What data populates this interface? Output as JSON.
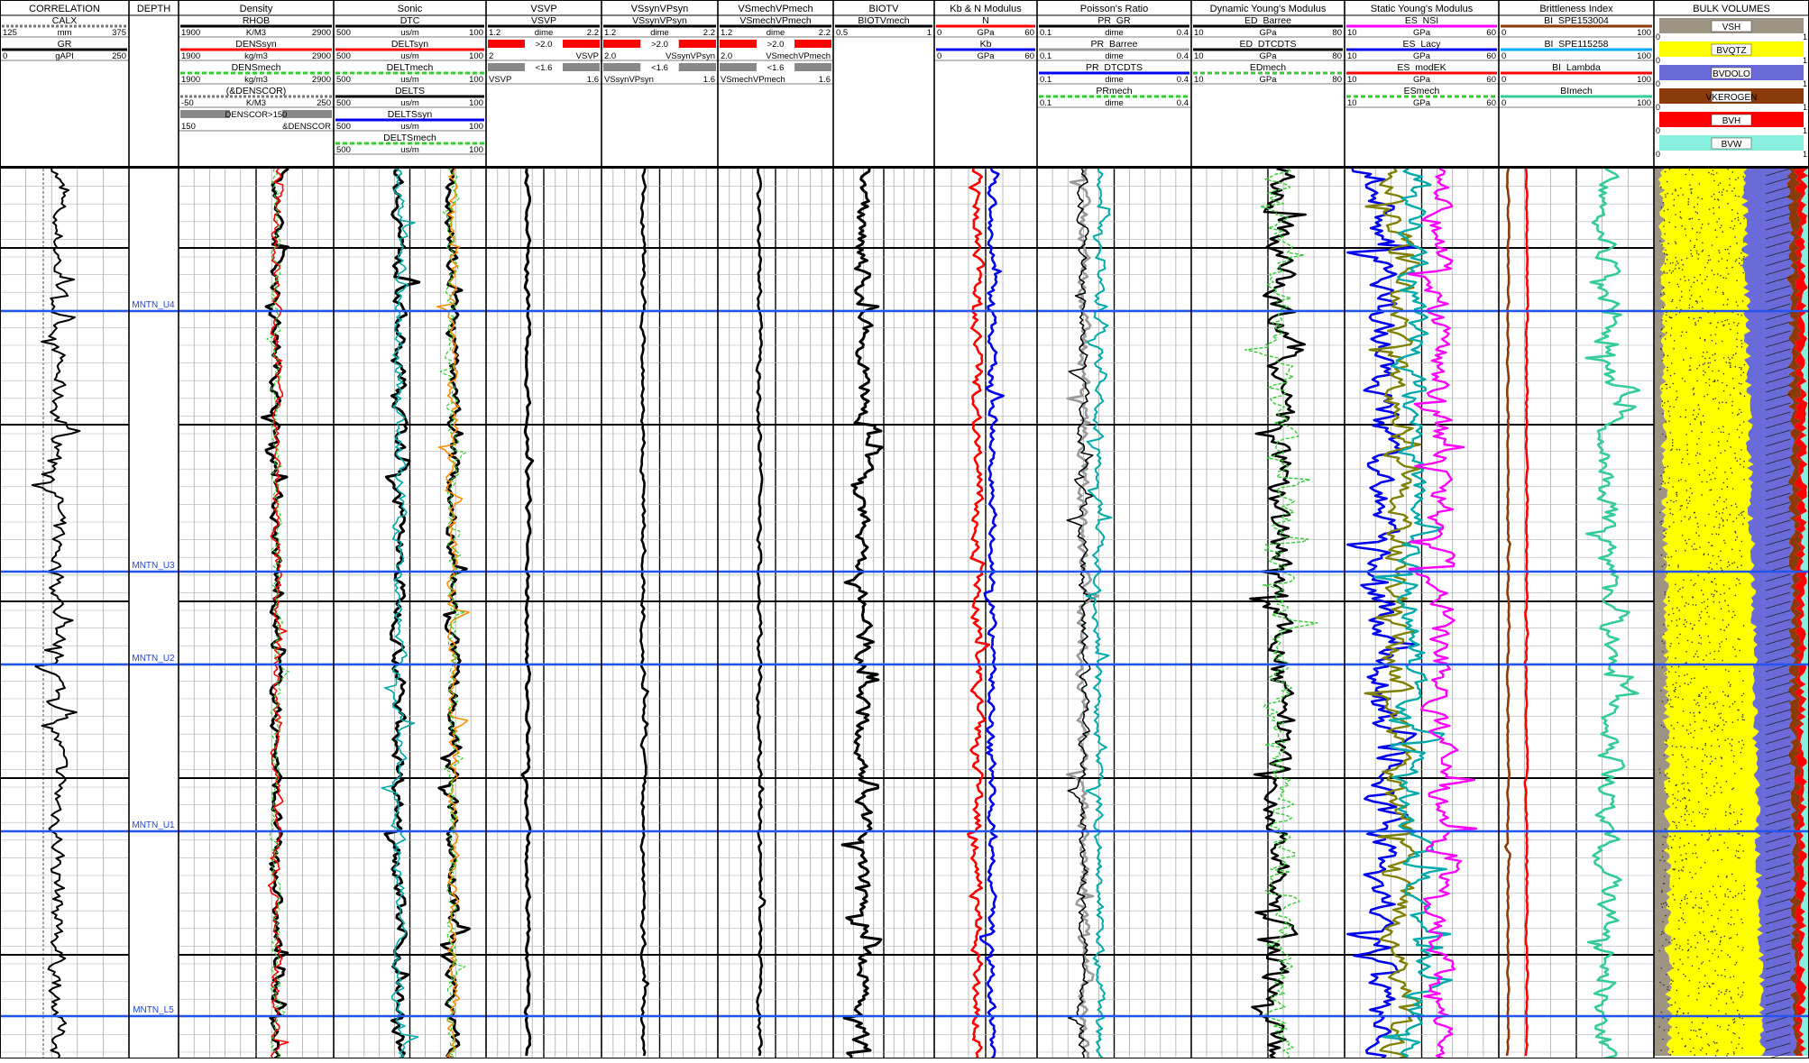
{
  "tracks": [
    {
      "title": "CORRELATION",
      "curves": [
        {
          "name": "CALX",
          "min": "125",
          "unit": "mm",
          "max": "375",
          "color": "#777777",
          "dash": "3,2"
        },
        {
          "name": "GR",
          "min": "0",
          "unit": "gAPI",
          "max": "250",
          "color": "#000000"
        }
      ]
    },
    {
      "title": "DEPTH",
      "curves": []
    },
    {
      "title": "Density",
      "curves": [
        {
          "name": "RHOB",
          "min": "1900",
          "unit": "K/M3",
          "max": "2900",
          "color": "#000000"
        },
        {
          "name": "DENSsyn",
          "min": "1900",
          "unit": "kg/m3",
          "max": "2900",
          "color": "#ff0000"
        },
        {
          "name": "DENSmech",
          "min": "1900",
          "unit": "kg/m3",
          "max": "2900",
          "color": "#33cc33",
          "dash": "5,3"
        },
        {
          "name": "(&DENSCOR)",
          "min": "-50",
          "unit": "K/M3",
          "max": "250",
          "color": "#777777",
          "dash": "3,2"
        }
      ],
      "extras": [
        {
          "kind": "fill",
          "label": "DENSCOR>150",
          "color": "#888888"
        },
        {
          "kind": "text",
          "left": "150",
          "right": "&DENSCOR"
        }
      ]
    },
    {
      "title": "Sonic",
      "curves": [
        {
          "name": "DTC",
          "min": "500",
          "unit": "us/m",
          "max": "100",
          "color": "#000000"
        },
        {
          "name": "DELTsyn",
          "min": "500",
          "unit": "us/m",
          "max": "100",
          "color": "#ff0000"
        },
        {
          "name": "DELTmech",
          "min": "500",
          "unit": "us/m",
          "max": "100",
          "color": "#33cc33",
          "dash": "5,3"
        },
        {
          "name": "DELTS",
          "min": "500",
          "unit": "us/m",
          "max": "100",
          "color": "#000000"
        },
        {
          "name": "DELTSsyn",
          "min": "500",
          "unit": "us/m",
          "max": "100",
          "color": "#0000ee"
        },
        {
          "name": "DELTSmech",
          "min": "500",
          "unit": "us/m",
          "max": "100",
          "color": "#33cc33",
          "dash": "5,3"
        }
      ]
    },
    {
      "title": "VSVP",
      "curves": [
        {
          "name": "VSVP",
          "min": "1.2",
          "unit": "dime",
          "max": "2.2",
          "color": "#000000"
        }
      ],
      "extras": [
        {
          "kind": "fill",
          "label": ">2.0",
          "color": "#ff0000"
        },
        {
          "kind": "text",
          "left": "2",
          "right": "VSVP"
        },
        {
          "kind": "fill",
          "label": "<1.6",
          "color": "#888888"
        },
        {
          "kind": "text",
          "left": "VSVP",
          "right": "1.6"
        }
      ]
    },
    {
      "title": "VSsynVPsyn",
      "curves": [
        {
          "name": "VSsynVPsyn",
          "min": "1.2",
          "unit": "dime",
          "max": "2.2",
          "color": "#000000"
        }
      ],
      "extras": [
        {
          "kind": "fill",
          "label": ">2.0",
          "color": "#ff0000"
        },
        {
          "kind": "text",
          "left": "2.0",
          "right": "VSsynVPsyn"
        },
        {
          "kind": "fill",
          "label": "<1.6",
          "color": "#888888"
        },
        {
          "kind": "text",
          "left": "VSsynVPsyn",
          "right": "1.6"
        }
      ]
    },
    {
      "title": "VSmechVPmech",
      "curves": [
        {
          "name": "VSmechVPmech",
          "min": "1.2",
          "unit": "dime",
          "max": "2.2",
          "color": "#000000"
        }
      ],
      "extras": [
        {
          "kind": "fill",
          "label": ">2.0",
          "color": "#ff0000"
        },
        {
          "kind": "text",
          "left": "2.0",
          "right": "VSmechVPmech"
        },
        {
          "kind": "fill",
          "label": "<1.6",
          "color": "#888888"
        },
        {
          "kind": "text",
          "left": "VSmechVPmech",
          "right": "1.6"
        }
      ]
    },
    {
      "title": "BIOTV",
      "curves": [
        {
          "name": "BIOTVmech",
          "min": "0.5",
          "unit": "",
          "max": "1",
          "color": "#000000"
        }
      ]
    },
    {
      "title": "Kb & N Modulus",
      "curves": [
        {
          "name": "N",
          "min": "0",
          "unit": "GPa",
          "max": "60",
          "color": "#ff0000"
        },
        {
          "name": "Kb",
          "min": "0",
          "unit": "GPa",
          "max": "60",
          "color": "#0000ee"
        }
      ]
    },
    {
      "title": "Poisson's Ratio",
      "curves": [
        {
          "name": "PR_GR",
          "min": "0.1",
          "unit": "dime",
          "max": "0.4",
          "color": "#000000"
        },
        {
          "name": "PR_Barree",
          "min": "0.1",
          "unit": "dime",
          "max": "0.4",
          "color": "#999999"
        },
        {
          "name": "PR_DTCDTS",
          "min": "0.1",
          "unit": "dime",
          "max": "0.4",
          "color": "#0000ee"
        },
        {
          "name": "PRmech",
          "min": "0.1",
          "unit": "dime",
          "max": "0.4",
          "color": "#33cc33",
          "dash": "5,3"
        }
      ]
    },
    {
      "title": "Dynamic Young's Modulus",
      "curves": [
        {
          "name": "ED_Barree",
          "min": "10",
          "unit": "GPa",
          "max": "80",
          "color": "#000000"
        },
        {
          "name": "ED_DTCDTS",
          "min": "10",
          "unit": "GPa",
          "max": "80",
          "color": "#000000"
        },
        {
          "name": "EDmech",
          "min": "10",
          "unit": "GPa",
          "max": "80",
          "color": "#33cc33",
          "dash": "5,3"
        }
      ]
    },
    {
      "title": "Static Young's Modulus",
      "curves": [
        {
          "name": "ES_NSI",
          "min": "10",
          "unit": "GPa",
          "max": "60",
          "color": "#ff00ff"
        },
        {
          "name": "ES_Lacy",
          "min": "10",
          "unit": "GPa",
          "max": "60",
          "color": "#0000ee"
        },
        {
          "name": "ES_modEK",
          "min": "10",
          "unit": "GPa",
          "max": "60",
          "color": "#ff0000"
        },
        {
          "name": "ESmech",
          "min": "10",
          "unit": "GPa",
          "max": "60",
          "color": "#33cc33",
          "dash": "5,3"
        }
      ]
    },
    {
      "title": "Brittleness Index",
      "curves": [
        {
          "name": "BI_SPE153004",
          "min": "0",
          "unit": "",
          "max": "100",
          "color": "#8b3a0a"
        },
        {
          "name": "BI_SPE115258",
          "min": "0",
          "unit": "",
          "max": "100",
          "color": "#00aaff"
        },
        {
          "name": "BI_Lambda",
          "min": "0",
          "unit": "",
          "max": "100",
          "color": "#ff0000"
        },
        {
          "name": "BImech",
          "min": "0",
          "unit": "",
          "max": "100",
          "color": "#33cc99"
        }
      ]
    },
    {
      "title": "BULK VOLUMES",
      "curves": [],
      "bulk": [
        {
          "name": "VSH",
          "min": "0",
          "max": "1",
          "color": "#9e9484"
        },
        {
          "name": "BVQTZ",
          "min": "0",
          "max": "1",
          "color": "#ffff00"
        },
        {
          "name": "BVDOLO",
          "min": "0",
          "max": "1",
          "color": "#6a6ad8"
        },
        {
          "name": "VKEROGEN",
          "min": "0",
          "max": "1",
          "color": "#8b3a0a"
        },
        {
          "name": "BVH",
          "min": "0",
          "max": "1",
          "color": "#ff0000"
        },
        {
          "name": "BVW",
          "min": "0",
          "max": "1",
          "color": "#88eedd"
        }
      ]
    }
  ],
  "chart_data": {
    "type": "line",
    "title": "",
    "tracks": [
      "CORRELATION",
      "DEPTH",
      "Density",
      "Sonic",
      "VSVP",
      "VSsynVPsyn",
      "VSmechVPmech",
      "BIOTV",
      "Kb & N Modulus",
      "Poisson's Ratio",
      "Dynamic Young's Modulus",
      "Static Young's Modulus",
      "Brittleness Index",
      "BULK VOLUMES"
    ],
    "depth_axis": "DEPTH",
    "formation_tops": [
      "MNTN_U4",
      "MNTN_U3",
      "MNTN_U2",
      "MNTN_U1",
      "MNTN_L5"
    ],
    "grid": true
  }
}
